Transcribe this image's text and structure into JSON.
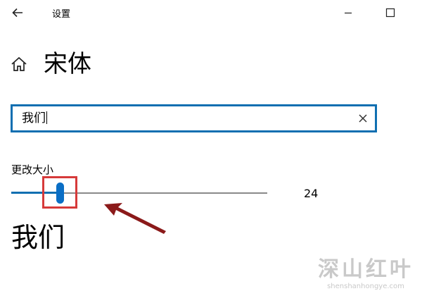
{
  "window": {
    "title": "设置"
  },
  "page": {
    "title": "宋体"
  },
  "search": {
    "value": "我们",
    "placeholder": ""
  },
  "size": {
    "label": "更改大小",
    "value": "24",
    "slider_fraction": 0.19
  },
  "preview": {
    "text": "我们"
  },
  "colors": {
    "accent": "#0f6fb1",
    "highlight": "#d63a3a",
    "arrow": "#8b1a1a"
  },
  "icons": [
    "back-arrow-icon",
    "minimize-icon",
    "maximize-icon",
    "home-icon",
    "clear-icon"
  ],
  "watermark": {
    "logo_text": "深山红叶",
    "url": "shenshanhongye.com"
  }
}
